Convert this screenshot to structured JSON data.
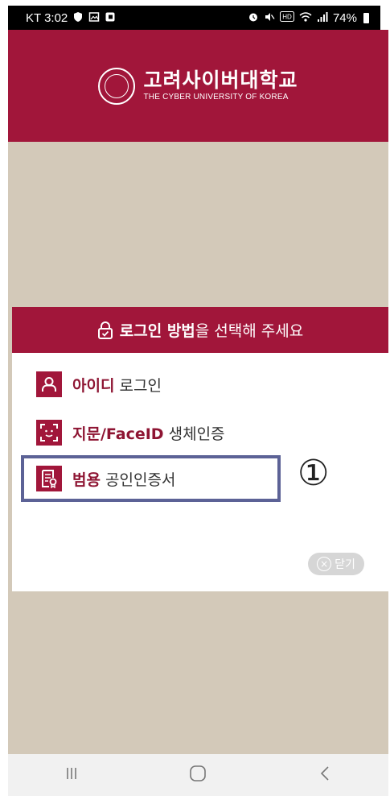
{
  "status_bar": {
    "carrier_time": "KT 3:02",
    "left_icons": [
      "shield-icon",
      "image-icon",
      "app-icon"
    ],
    "right_icons": [
      "alarm-icon",
      "mute-icon",
      "hd-icon",
      "wifi-icon",
      "signal-icon"
    ],
    "battery": "74%"
  },
  "header": {
    "university_name_ko": "고려사이버대학교",
    "university_name_en": "THE CYBER UNIVERSITY OF KOREA",
    "background_color": "#a1163a"
  },
  "dialog": {
    "title_strong": "로그인 방법",
    "title_rest": "을 선택해 주세요",
    "options": [
      {
        "icon": "person-icon",
        "strong": "아이디",
        "rest": " 로그인"
      },
      {
        "icon": "face-id-icon",
        "strong": "지문/FaceID",
        "rest": " 생체인증"
      },
      {
        "icon": "certificate-icon",
        "strong": "범용",
        "rest": " 공인인증서"
      }
    ],
    "step_marker": "①",
    "close_label": "닫기"
  },
  "nav_bar": {
    "recent": "|||",
    "home": "○",
    "back": "<"
  },
  "colors": {
    "accent": "#a1163a",
    "backdrop": "#d3c9b9",
    "highlight_border": "#5c6296"
  }
}
